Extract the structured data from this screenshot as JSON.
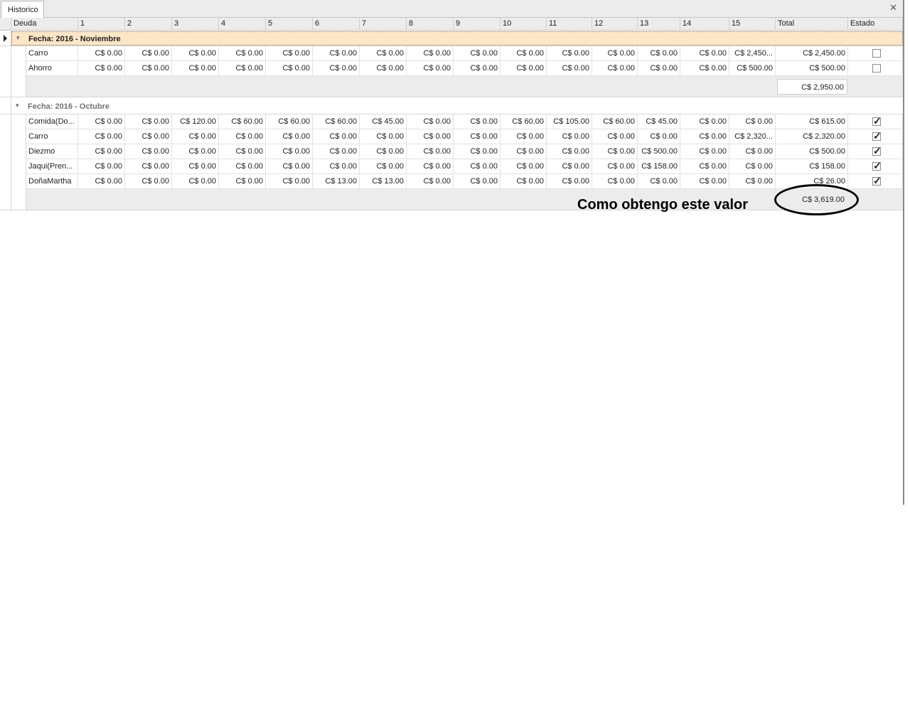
{
  "tab": {
    "title": "Historico",
    "close_glyph": "✕"
  },
  "columns": [
    "Deuda",
    "1",
    "2",
    "3",
    "4",
    "5",
    "6",
    "7",
    "8",
    "9",
    "10",
    "11",
    "12",
    "13",
    "14",
    "15",
    "Total",
    "Estado"
  ],
  "groups": [
    {
      "label": "Fecha: 2016 - Noviembre",
      "focused": true,
      "rows": [
        {
          "deuda": "Carro",
          "days": [
            "C$ 0.00",
            "C$ 0.00",
            "C$ 0.00",
            "C$ 0.00",
            "C$ 0.00",
            "C$ 0.00",
            "C$ 0.00",
            "C$ 0.00",
            "C$ 0.00",
            "C$ 0.00",
            "C$ 0.00",
            "C$ 0.00",
            "C$ 0.00",
            "C$ 0.00",
            "C$ 2,450..."
          ],
          "total": "C$ 2,450.00",
          "estado": false
        },
        {
          "deuda": "Ahorro",
          "days": [
            "C$ 0.00",
            "C$ 0.00",
            "C$ 0.00",
            "C$ 0.00",
            "C$ 0.00",
            "C$ 0.00",
            "C$ 0.00",
            "C$ 0.00",
            "C$ 0.00",
            "C$ 0.00",
            "C$ 0.00",
            "C$ 0.00",
            "C$ 0.00",
            "C$ 0.00",
            "C$ 500.00"
          ],
          "total": "C$ 500.00",
          "estado": false
        }
      ],
      "summary_total": "C$ 2,950.00"
    },
    {
      "label": "Fecha: 2016 - Octubre",
      "focused": false,
      "rows": [
        {
          "deuda": "Comida(Do...",
          "days": [
            "C$ 0.00",
            "C$ 0.00",
            "C$ 120.00",
            "C$ 60.00",
            "C$ 60.00",
            "C$ 60.00",
            "C$ 45.00",
            "C$ 0.00",
            "C$ 0.00",
            "C$ 60.00",
            "C$ 105.00",
            "C$ 60.00",
            "C$ 45.00",
            "C$ 0.00",
            "C$ 0.00"
          ],
          "total": "C$ 615.00",
          "estado": true
        },
        {
          "deuda": "Carro",
          "days": [
            "C$ 0.00",
            "C$ 0.00",
            "C$ 0.00",
            "C$ 0.00",
            "C$ 0.00",
            "C$ 0.00",
            "C$ 0.00",
            "C$ 0.00",
            "C$ 0.00",
            "C$ 0.00",
            "C$ 0.00",
            "C$ 0.00",
            "C$ 0.00",
            "C$ 0.00",
            "C$ 2,320..."
          ],
          "total": "C$ 2,320.00",
          "estado": true
        },
        {
          "deuda": "Diezmo",
          "days": [
            "C$ 0.00",
            "C$ 0.00",
            "C$ 0.00",
            "C$ 0.00",
            "C$ 0.00",
            "C$ 0.00",
            "C$ 0.00",
            "C$ 0.00",
            "C$ 0.00",
            "C$ 0.00",
            "C$ 0.00",
            "C$ 0.00",
            "C$ 500.00",
            "C$ 0.00",
            "C$ 0.00"
          ],
          "total": "C$ 500.00",
          "estado": true
        },
        {
          "deuda": "Jaqui(Pren...",
          "days": [
            "C$ 0.00",
            "C$ 0.00",
            "C$ 0.00",
            "C$ 0.00",
            "C$ 0.00",
            "C$ 0.00",
            "C$ 0.00",
            "C$ 0.00",
            "C$ 0.00",
            "C$ 0.00",
            "C$ 0.00",
            "C$ 0.00",
            "C$ 158.00",
            "C$ 0.00",
            "C$ 0.00"
          ],
          "total": "C$ 158.00",
          "estado": true
        },
        {
          "deuda": "DoñaMartha",
          "days": [
            "C$ 0.00",
            "C$ 0.00",
            "C$ 0.00",
            "C$ 0.00",
            "C$ 0.00",
            "C$ 13.00",
            "C$ 13.00",
            "C$ 0.00",
            "C$ 0.00",
            "C$ 0.00",
            "C$ 0.00",
            "C$ 0.00",
            "C$ 0.00",
            "C$ 0.00",
            "C$ 0.00"
          ],
          "total": "C$ 26.00",
          "estado": true
        }
      ],
      "summary_total": "C$ 3,619.00"
    }
  ],
  "annotation": {
    "text": "Como obtengo este valor"
  }
}
